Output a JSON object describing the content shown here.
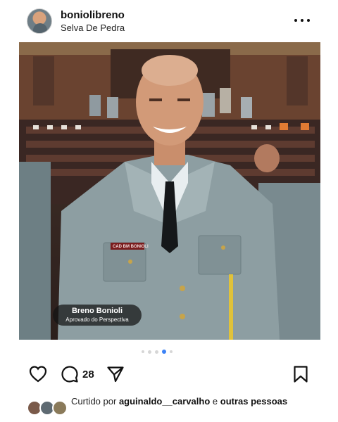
{
  "post": {
    "username": "boniolibreno",
    "location": "Selva De Pedra",
    "caption_badge": {
      "name": "Breno Bonioli",
      "subtitle": "Aprovado do Perspectiva"
    },
    "uniform_tag": "CAD BM BONIOLI",
    "carousel": {
      "count": 5,
      "active_index": 3
    },
    "comment_count": "28",
    "liked_by": {
      "prefix": "Curtido por",
      "user": "aguinaldo__carvalho",
      "connector": "e",
      "others": "outras pessoas"
    }
  },
  "colors": {
    "carousel_active": "#3b82f6",
    "carousel_inactive": "#d6d6d6"
  },
  "icons": [
    "more-icon",
    "mute-icon",
    "heart-icon",
    "comment-icon",
    "share-icon",
    "bookmark-icon"
  ]
}
